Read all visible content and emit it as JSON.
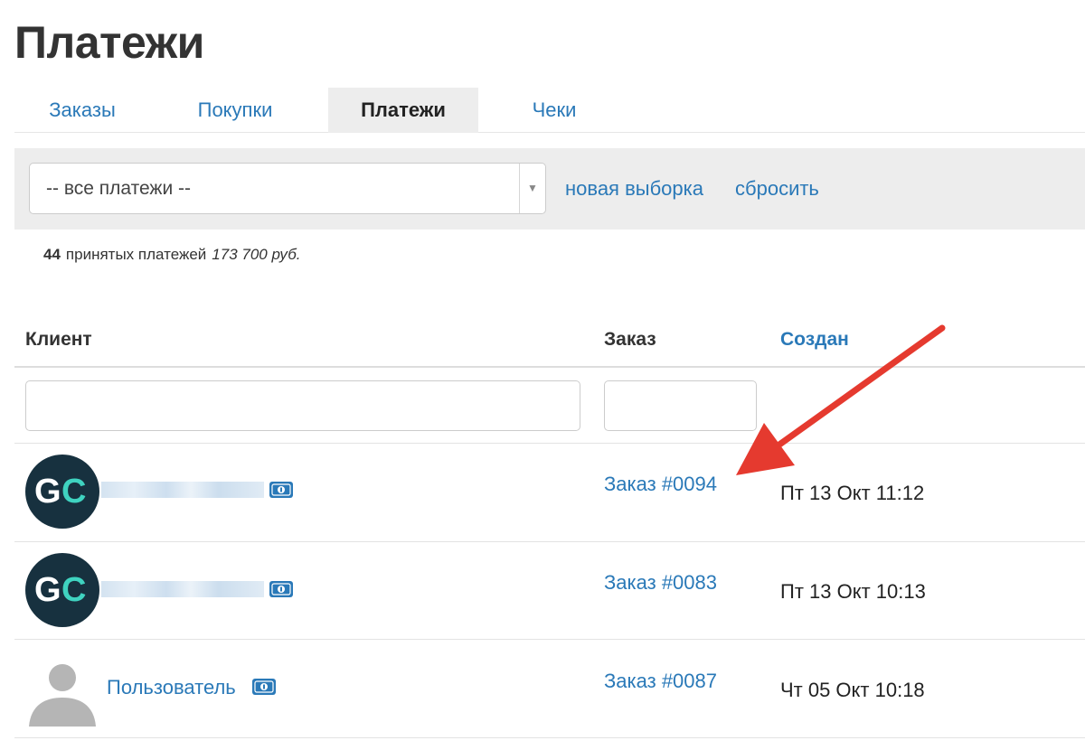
{
  "page": {
    "title": "Платежи"
  },
  "tabs": [
    {
      "label": "Заказы",
      "active": false
    },
    {
      "label": "Покупки",
      "active": false
    },
    {
      "label": "Платежи",
      "active": true
    },
    {
      "label": "Чеки",
      "active": false
    }
  ],
  "filter": {
    "select_value": "-- все платежи --",
    "new_selection": "новая выборка",
    "reset": "сбросить"
  },
  "summary": {
    "count": "44",
    "label": "принятых платежей",
    "total": "173 700 руб."
  },
  "table": {
    "columns": {
      "client": "Клиент",
      "order": "Заказ",
      "created": "Создан"
    },
    "rows": [
      {
        "client": "",
        "avatar": "gc-logo",
        "order": "Заказ #0094",
        "created": "Пт 13 Окт 11:12"
      },
      {
        "client": "",
        "avatar": "gc-logo",
        "order": "Заказ #0083",
        "created": "Пт 13 Окт 10:13"
      },
      {
        "client": "Пользователь",
        "avatar": "user-silhouette",
        "order": "Заказ #0087",
        "created": "Чт 05 Окт 10:18"
      }
    ]
  },
  "avatar_logo": {
    "letter1": "G",
    "letter2": "C"
  },
  "colors": {
    "link": "#2a79b8",
    "annotation_arrow": "#e53a2f",
    "logo_bg": "#17313f",
    "logo_accent": "#3fd3c0"
  }
}
